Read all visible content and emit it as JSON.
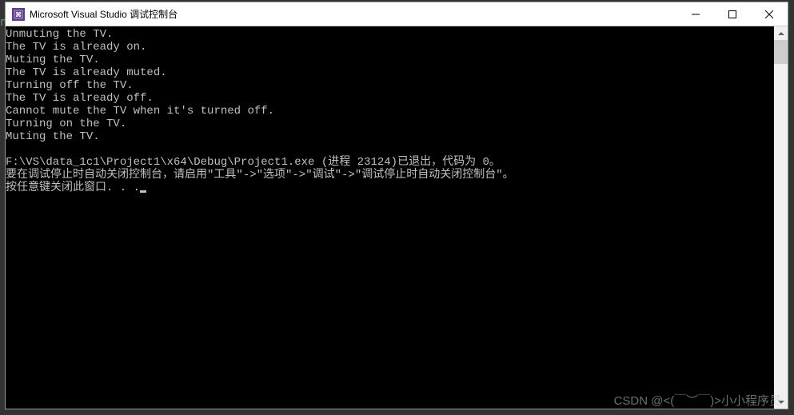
{
  "window": {
    "icon_text": "⬛",
    "title": "Microsoft Visual Studio 调试控制台"
  },
  "console": {
    "lines": [
      "Unmuting the TV.",
      "The TV is already on.",
      "Muting the TV.",
      "The TV is already muted.",
      "Turning off the TV.",
      "The TV is already off.",
      "Cannot mute the TV when it's turned off.",
      "Turning on the TV.",
      "Muting the TV.",
      "",
      "F:\\VS\\data_1c1\\Project1\\x64\\Debug\\Project1.exe (进程 23124)已退出，代码为 0。",
      "要在调试停止时自动关闭控制台，请启用\"工具\"->\"选项\"->\"调试\"->\"调试停止时自动关闭控制台\"。",
      "按任意键关闭此窗口. . ."
    ]
  },
  "watermark": "CSDN @<(￣︶￣)>小小程序员",
  "left_edge_char": "n"
}
